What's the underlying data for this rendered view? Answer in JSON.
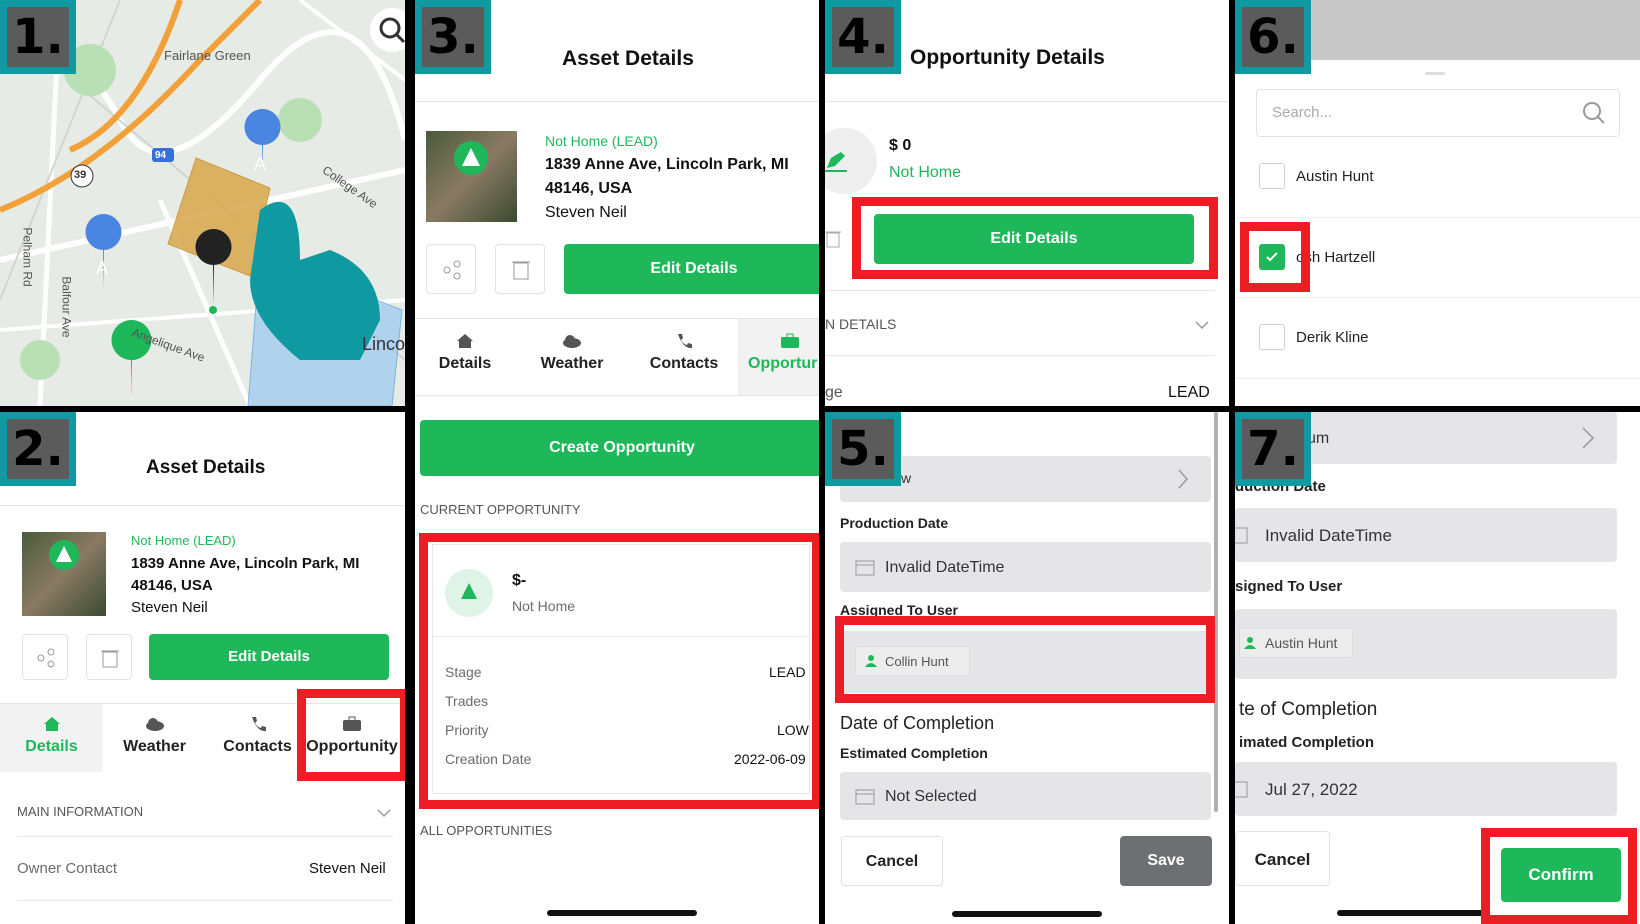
{
  "colors": {
    "accent_green": "#1eb85a",
    "highlight_red": "#ee1c25",
    "badge_teal": "#0e9aa0"
  },
  "p1": {
    "badge": "1.",
    "labels": [
      "Fairlane Green",
      "College Ave",
      "Angelique Ave",
      "Pelham Rd",
      "Balfour Ave",
      "Linco",
      "39",
      "94",
      "A"
    ]
  },
  "p2": {
    "badge": "2.",
    "title": "Asset Details",
    "status": "Not Home (LEAD)",
    "address1": "1839 Anne Ave, Lincoln Park, MI",
    "address2": "48146, USA",
    "owner": "Steven Neil",
    "edit_btn": "Edit Details",
    "tabs": [
      "Details",
      "Weather",
      "Contacts",
      "Opportunity"
    ],
    "section": "MAIN INFORMATION",
    "owner_contact_label": "Owner Contact"
  },
  "p3": {
    "badge": "3.",
    "title": "Asset Details",
    "status": "Not Home (LEAD)",
    "address1": "1839 Anne Ave, Lincoln Park, MI",
    "address2": "48146, USA",
    "owner": "Steven Neil",
    "edit_btn": "Edit Details",
    "tabs": [
      "Details",
      "Weather",
      "Contacts",
      "Opportur"
    ],
    "create_btn": "Create Opportunity",
    "current_header": "CURRENT OPPORTUNITY",
    "card": {
      "amount": "$-",
      "status": "Not Home",
      "rows": [
        {
          "label": "Stage",
          "value": "LEAD"
        },
        {
          "label": "Trades",
          "value": ""
        },
        {
          "label": "Priority",
          "value": "LOW"
        },
        {
          "label": "Creation Date",
          "value": "2022-06-09"
        }
      ]
    },
    "all_header": "ALL OPPORTUNITIES"
  },
  "p4": {
    "badge": "4.",
    "title": "Opportunity Details",
    "amount": "$ 0",
    "status": "Not Home",
    "edit_btn": "Edit Details",
    "section": "N DETAILS",
    "stage_label": "ge",
    "stage_value": "LEAD"
  },
  "p5": {
    "badge": "5.",
    "top_field": "w",
    "production_label": "Production Date",
    "production_value": "Invalid DateTime",
    "assigned_label": "Assigned To User",
    "assigned_value": "Collin Hunt",
    "completion_header": "Date of Completion",
    "estimated_label": "Estimated Completion",
    "estimated_value": "Not Selected",
    "cancel": "Cancel",
    "save": "Save"
  },
  "p6": {
    "badge": "6.",
    "search_placeholder": "Search...",
    "users": [
      "Austin Hunt",
      "osh Hartzell",
      "Derik Kline"
    ]
  },
  "p7": {
    "badge": "7.",
    "top_field": "um",
    "production_label": "duction Date",
    "production_value": "Invalid DateTime",
    "assigned_label": "signed To User",
    "assigned_value": "Austin Hunt",
    "completion_header": "te of Completion",
    "estimated_label": "imated Completion",
    "estimated_value": "Jul 27, 2022",
    "cancel": "Cancel",
    "confirm": "Confirm"
  }
}
